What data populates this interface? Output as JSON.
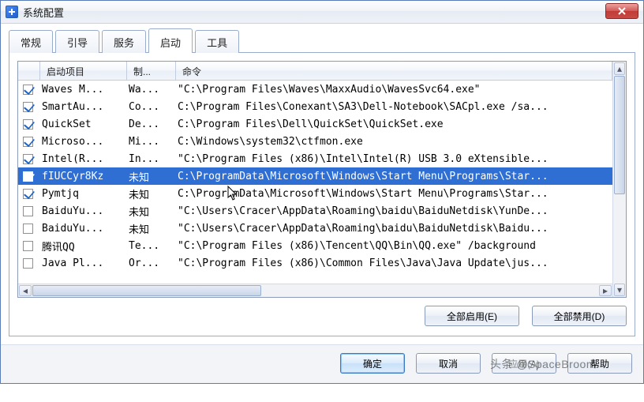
{
  "window": {
    "title": "系统配置"
  },
  "tabs": [
    "常规",
    "引导",
    "服务",
    "启动",
    "工具"
  ],
  "active_tab_index": 3,
  "columns": {
    "item": "启动项目",
    "maker": "制...",
    "command": "命令"
  },
  "col_widths": {
    "chk": 28,
    "item": 110,
    "maker": 62,
    "command": 540
  },
  "selected_index": 5,
  "rows": [
    {
      "checked": true,
      "item": "Waves M...",
      "maker": "Wa...",
      "command": "\"C:\\Program Files\\Waves\\MaxxAudio\\WavesSvc64.exe\""
    },
    {
      "checked": true,
      "item": "SmartAu...",
      "maker": "Co...",
      "command": "C:\\Program Files\\Conexant\\SA3\\Dell-Notebook\\SACpl.exe /sa..."
    },
    {
      "checked": true,
      "item": "QuickSet",
      "maker": "De...",
      "command": "C:\\Program Files\\Dell\\QuickSet\\QuickSet.exe"
    },
    {
      "checked": true,
      "item": "Microso...",
      "maker": "Mi...",
      "command": "C:\\Windows\\system32\\ctfmon.exe"
    },
    {
      "checked": true,
      "item": "Intel(R...",
      "maker": "In...",
      "command": "\"C:\\Program Files (x86)\\Intel\\Intel(R) USB 3.0 eXtensible..."
    },
    {
      "checked": true,
      "item": "fIUCCyr8Kz",
      "maker": "未知",
      "command": "C:\\ProgramData\\Microsoft\\Windows\\Start Menu\\Programs\\Star..."
    },
    {
      "checked": true,
      "item": "Pymtjq",
      "maker": "未知",
      "command": "C:\\ProgramData\\Microsoft\\Windows\\Start Menu\\Programs\\Star..."
    },
    {
      "checked": false,
      "item": "BaiduYu...",
      "maker": "未知",
      "command": "\"C:\\Users\\Cracer\\AppData\\Roaming\\baidu\\BaiduNetdisk\\YunDe..."
    },
    {
      "checked": false,
      "item": "BaiduYu...",
      "maker": "未知",
      "command": "\"C:\\Users\\Cracer\\AppData\\Roaming\\baidu\\BaiduNetdisk\\Baidu..."
    },
    {
      "checked": false,
      "item": "腾讯QQ",
      "maker": "Te...",
      "command": "\"C:\\Program Files (x86)\\Tencent\\QQ\\Bin\\QQ.exe\" /background"
    },
    {
      "checked": false,
      "item": "Java Pl...",
      "maker": "Or...",
      "command": "\"C:\\Program Files (x86)\\Common Files\\Java\\Java Update\\jus..."
    }
  ],
  "buttons": {
    "enable_all": "全部启用(E)",
    "disable_all": "全部禁用(D)",
    "ok": "确定",
    "cancel": "取消",
    "apply": "应用(A)",
    "help": "帮助"
  },
  "watermark": "头条 @SpaceBroom"
}
